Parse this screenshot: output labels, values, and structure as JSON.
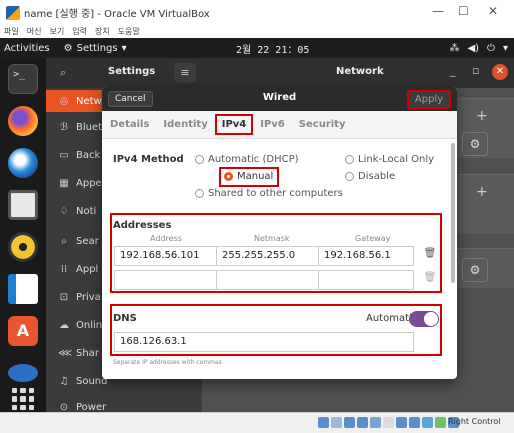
{
  "vbox": {
    "title": "name [실행 중] - Oracle VM VirtualBox",
    "menu": [
      "파일",
      "머신",
      "보기",
      "입력",
      "장치",
      "도움말"
    ],
    "min": "—",
    "max": "☐",
    "close": "✕",
    "host_key": "Right Control"
  },
  "topbar": {
    "activities": "Activities",
    "app": "Settings",
    "app_caret": "▾",
    "clock": "2월 22 21：05",
    "tray": [
      "⁂",
      "◀)",
      "⏻",
      "▾"
    ]
  },
  "settings": {
    "title": "Settings",
    "search_icon": "⌕",
    "menu_icon": "≡",
    "network_title": "Network",
    "min": "_",
    "max": "▫",
    "close": "✕",
    "sidebar": [
      {
        "icon": "◎",
        "label": "Netw"
      },
      {
        "icon": "ℬ",
        "label": "Bluet"
      },
      {
        "icon": "▭",
        "label": "Back"
      },
      {
        "icon": "▦",
        "label": "Appe"
      },
      {
        "icon": "♤",
        "label": "Noti"
      },
      {
        "icon": "⌕",
        "label": "Sear"
      },
      {
        "icon": "⁞⁞",
        "label": "Appl"
      },
      {
        "icon": "⊡",
        "label": "Priva"
      },
      {
        "icon": "☁",
        "label": "Onlin"
      },
      {
        "icon": "⋘",
        "label": "Shar"
      },
      {
        "icon": "♫",
        "label": "Sound"
      },
      {
        "icon": "⊙",
        "label": "Power"
      }
    ],
    "plus": "+",
    "gear": "⚙"
  },
  "dialog": {
    "cancel": "Cancel",
    "title": "Wired",
    "apply": "Apply",
    "tabs": [
      "Details",
      "Identity",
      "IPv4",
      "IPv6",
      "Security"
    ],
    "active_tab": "IPv4",
    "ipv4_method_label": "IPv4 Method",
    "methods": {
      "automatic": "Automatic (DHCP)",
      "link_local": "Link-Local Only",
      "manual": "Manual",
      "disable": "Disable",
      "shared": "Shared to other computers"
    },
    "selected_method": "Manual",
    "addresses_label": "Addresses",
    "columns": [
      "Address",
      "Netmask",
      "Gateway"
    ],
    "rows": [
      [
        "192.168.56.101",
        "255.255.255.0",
        "192.168.56.1"
      ],
      [
        "",
        "",
        ""
      ]
    ],
    "trash_icon": "🗑",
    "dns_label": "DNS",
    "dns_automatic": "Automatic",
    "dns_automatic_on": true,
    "dns_value": "168.126.63.1",
    "dns_hint": "Separate IP addresses with commas"
  }
}
